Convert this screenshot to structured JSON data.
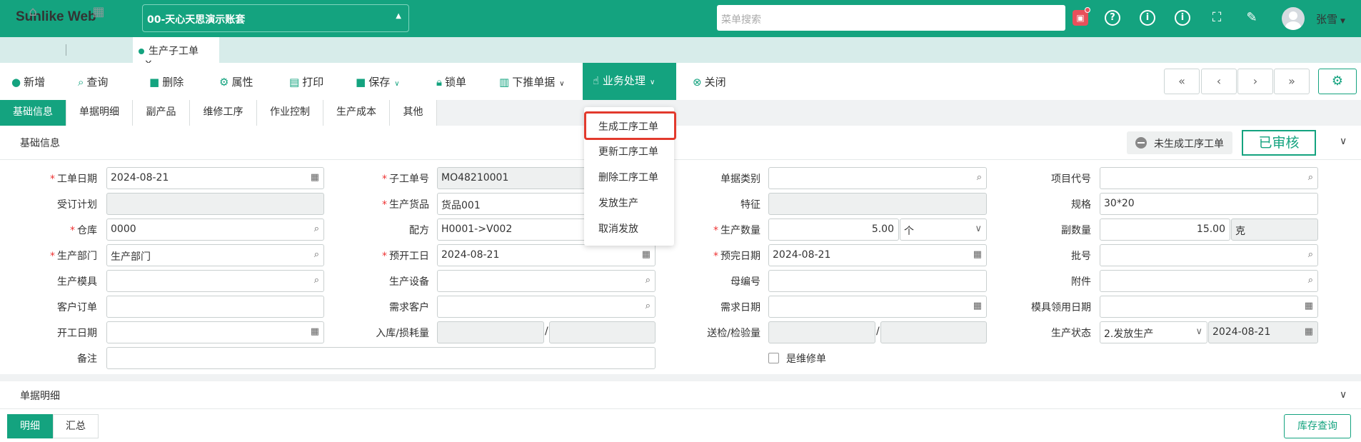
{
  "topbar": {
    "logo": "Sunlike Web",
    "account": "00-天心天思演示账套",
    "search_placeholder": "菜单搜索",
    "user": "张雪"
  },
  "tabs": {
    "doc_tab": "生产子工单",
    "close": "×"
  },
  "toolbar": {
    "add": "新增",
    "query": "查询",
    "delete": "删除",
    "attribute": "属性",
    "print": "打印",
    "save": "保存",
    "lock": "锁单",
    "push_down": "下推单据",
    "business": "业务处理",
    "close": "关闭"
  },
  "business_menu": [
    "生成工序工单",
    "更新工序工单",
    "删除工序工单",
    "发放生产",
    "取消发放"
  ],
  "subtabs": [
    "基础信息",
    "单据明细",
    "副产品",
    "维修工序",
    "作业控制",
    "生产成本",
    "其他"
  ],
  "panel": {
    "title": "基础信息",
    "process_status": "未生成工序工单",
    "approved": "已审核"
  },
  "form": {
    "row1": {
      "l1": "工单日期",
      "v1": "2024-08-21",
      "l2": "子工单号",
      "v2": "MO48210001",
      "l3": "单据类别",
      "v3": "",
      "l4": "项目代号",
      "v4": ""
    },
    "row2": {
      "l1": "受订计划",
      "v1": "",
      "l2": "生产货品",
      "v2": "货品001",
      "l3": "特征",
      "v3": "",
      "l4": "规格",
      "v4": "30*20"
    },
    "row3": {
      "l1": "仓库",
      "v1": "0000",
      "l2": "配方",
      "v2": "H0001->V002",
      "l3": "生产数量",
      "v3": "5.00",
      "v3b": "个",
      "l4": "副数量",
      "v4": "15.00",
      "v4b": "克"
    },
    "row4": {
      "l1": "生产部门",
      "v1": "生产部门",
      "l2": "预开工日",
      "v2": "2024-08-21",
      "l3": "预完日期",
      "v3": "2024-08-21",
      "l4": "批号",
      "v4": ""
    },
    "row5": {
      "l1": "生产模具",
      "v1": "",
      "l2": "生产设备",
      "v2": "",
      "l3": "母编号",
      "v3": "",
      "l4": "附件",
      "v4": ""
    },
    "row6": {
      "l1": "客户订单",
      "v1": "",
      "l2": "需求客户",
      "v2": "",
      "l3": "需求日期",
      "v3": "",
      "l4": "模具领用日期",
      "v4": ""
    },
    "row7": {
      "l1": "开工日期",
      "v1": "",
      "l2": "入库/损耗量",
      "v2": "",
      "l3": "送检/检验量",
      "v3": "",
      "l4": "生产状态",
      "v4": "2.发放生产",
      "v4b": "2024-08-21"
    },
    "row8": {
      "l1": "备注",
      "v1": "",
      "checkbox": "是维修单"
    },
    "slash": "/"
  },
  "section2": "单据明细",
  "bottom": {
    "detail": "明细",
    "summary": "汇总",
    "inventory": "库存查询"
  },
  "colors": {
    "primary": "#14a37f",
    "highlight": "#e23a2d"
  }
}
